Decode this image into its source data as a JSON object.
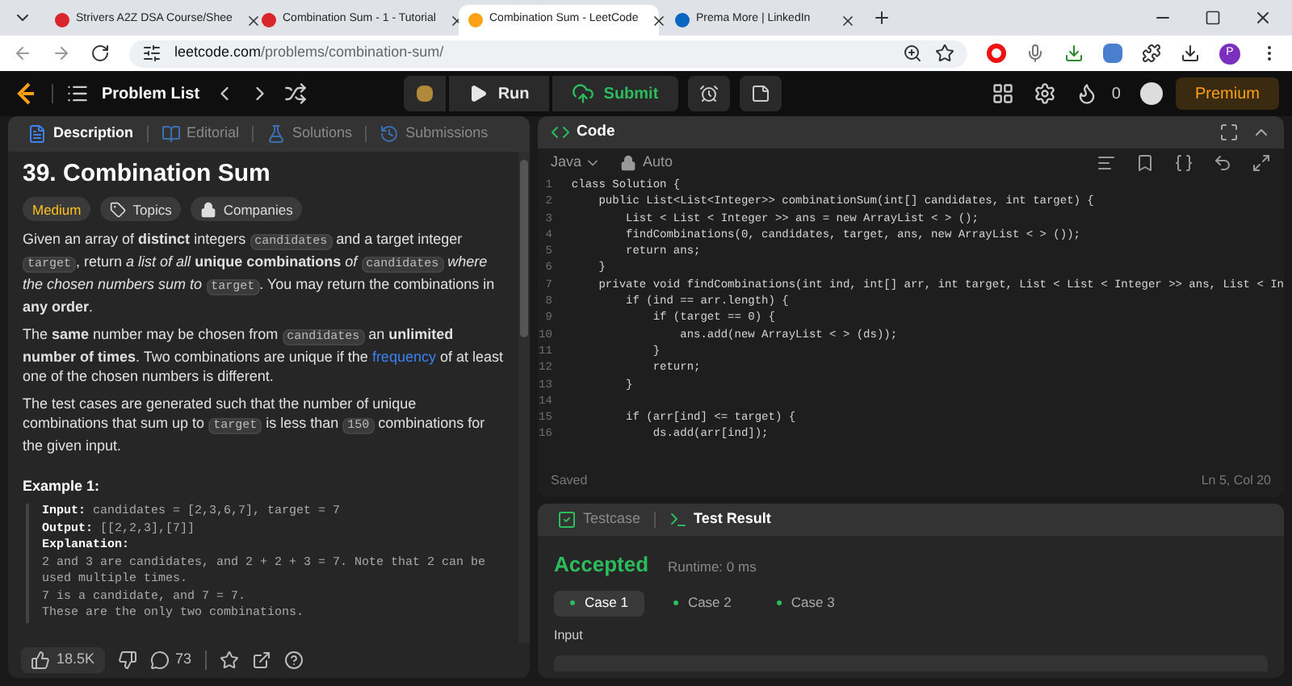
{
  "browser": {
    "tabs": [
      {
        "title": "Strivers A2Z DSA Course/Shee",
        "selected": false,
        "color": "#d9262c"
      },
      {
        "title": "Combination Sum - 1 - Tutorial",
        "selected": false,
        "color": "#d9262c"
      },
      {
        "title": "Combination Sum - LeetCode",
        "selected": true,
        "color": "#ffa116"
      },
      {
        "title": "Prema More | LinkedIn",
        "selected": false,
        "color": "#0a66c2"
      }
    ],
    "url_host": "leetcode.com",
    "url_path": "/problems/combination-sum/",
    "profile": "P"
  },
  "nav": {
    "problem_list": "Problem List",
    "run": "Run",
    "submit": "Submit",
    "streak": "0",
    "premium": "Premium"
  },
  "description": {
    "tabs": [
      {
        "label": "Description",
        "selected": true
      },
      {
        "label": "Editorial",
        "selected": false
      },
      {
        "label": "Solutions",
        "selected": false
      },
      {
        "label": "Submissions",
        "selected": false
      }
    ],
    "title": "39. Combination Sum",
    "difficulty": "Medium",
    "tags": [
      "Topics",
      "Companies"
    ],
    "paragraphs": [
      [
        {
          "kind": "text",
          "text": "Given an array of **distinct** integers "
        },
        {
          "kind": "code",
          "text": "candidates"
        },
        {
          "kind": "text",
          "text": " and a target integer "
        },
        {
          "kind": "code",
          "text": "target"
        },
        {
          "kind": "text",
          "text": ", return *a list of all* **unique combinations** *of* "
        },
        {
          "kind": "code",
          "text": "candidates"
        },
        {
          "kind": "text",
          "text": " *where the chosen numbers sum to* "
        },
        {
          "kind": "code",
          "text": "target"
        },
        {
          "kind": "text",
          "text": ". You may return the combinations in **any order**."
        }
      ],
      [
        {
          "kind": "text",
          "text": "The **same** number may be chosen from "
        },
        {
          "kind": "code",
          "text": "candidates"
        },
        {
          "kind": "text",
          "text": " an **unlimited number of times**. Two combinations are unique if the "
        },
        {
          "kind": "link",
          "text": "frequency"
        },
        {
          "kind": "text",
          "text": " of at least one of the chosen numbers is different."
        }
      ],
      [
        {
          "kind": "text",
          "text": "The test cases are generated such that the number of unique combinations that sum up to "
        },
        {
          "kind": "code",
          "text": "target"
        },
        {
          "kind": "text",
          "text": " is less than "
        },
        {
          "kind": "code",
          "text": "150"
        },
        {
          "kind": "text",
          "text": " combinations for the given input."
        }
      ]
    ],
    "example_title": "Example 1:",
    "example_lines": [
      "**Input:** candidates = [2,3,6,7], target = 7",
      "**Output:** [[2,2,3],[7]]",
      "**Explanation:**",
      "2 and 3 are candidates, and 2 + 2 + 3 = 7. Note that 2 can be used multiple times.",
      "7 is a candidate, and 7 = 7.",
      "These are the only two combinations."
    ],
    "likes": "18.5K",
    "comments": "73"
  },
  "code": {
    "title": "Code",
    "language": "Java",
    "mode": "Auto",
    "lines": [
      {
        "number": "1",
        "text": "class Solution {"
      },
      {
        "number": "2",
        "text": "    public List<List<Integer>> combinationSum(int[] candidates, int target) {"
      },
      {
        "number": "3",
        "text": "        List < List < Integer >> ans = new ArrayList < > ();"
      },
      {
        "number": "4",
        "text": "        findCombinations(0, candidates, target, ans, new ArrayList < > ());"
      },
      {
        "number": "5",
        "text": "        return ans;"
      },
      {
        "number": "6",
        "text": "    }"
      },
      {
        "number": "7",
        "text": "    private void findCombinations(int ind, int[] arr, int target, List < List < Integer >> ans, List < In"
      },
      {
        "number": "8",
        "text": "        if (ind == arr.length) {"
      },
      {
        "number": "9",
        "text": "            if (target == 0) {"
      },
      {
        "number": "10",
        "text": "                ans.add(new ArrayList < > (ds));"
      },
      {
        "number": "11",
        "text": "            }"
      },
      {
        "number": "12",
        "text": "            return;"
      },
      {
        "number": "13",
        "text": "        }"
      },
      {
        "number": "14"
      },
      {
        "number": "15",
        "text": "        if (arr[ind] <= target) {"
      },
      {
        "number": "16",
        "text": "            ds.add(arr[ind]);"
      }
    ],
    "status": "Saved",
    "position": "Ln 5, Col 20"
  },
  "test": {
    "tabs": [
      {
        "label": "Testcase",
        "selected": false
      },
      {
        "label": "Test Result",
        "selected": true
      }
    ],
    "result": "Accepted",
    "runtime": "Runtime: 0 ms",
    "cases": [
      {
        "label": "Case 1",
        "selected": true
      },
      {
        "label": "Case 2",
        "selected": false
      },
      {
        "label": "Case 3",
        "selected": false
      }
    ],
    "input_label": "Input"
  }
}
